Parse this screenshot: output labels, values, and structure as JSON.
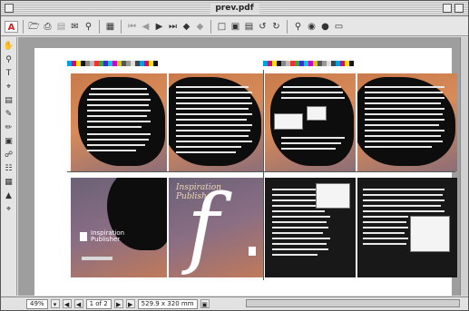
{
  "window": {
    "title": "prev.pdf"
  },
  "toolbar": {
    "icons": [
      "acrobat-logo-icon",
      "open-icon",
      "print-icon",
      "save-icon",
      "email-icon",
      "find-icon",
      "hand-icon",
      "first-page-icon",
      "previous-page-icon",
      "next-page-icon",
      "last-page-icon",
      "go-back-icon",
      "go-forward-icon",
      "actual-size-icon",
      "fit-page-icon",
      "fit-width-icon",
      "rotate-left-icon",
      "rotate-right-icon",
      "search-icon",
      "binoculars-icon",
      "web-icon",
      "cascade-icon"
    ]
  },
  "tools": [
    "hand-tool-icon",
    "zoom-tool-icon",
    "text-select-tool-icon",
    "crop-tool-icon",
    "note-tool-icon",
    "pencil-tool-icon",
    "highlight-tool-icon",
    "form-tool-icon",
    "link-tool-icon",
    "article-tool-icon",
    "movie-tool-icon",
    "stamp-tool-icon",
    "touchup-tool-icon"
  ],
  "document": {
    "cover": {
      "title_line1": "Inspiration",
      "title_line2": "Publisher",
      "initial": "f",
      "brand_line1": "Inspiration",
      "brand_line2": "Publisher"
    }
  },
  "status": {
    "zoom": "49%",
    "page_indicator": "1 of 2",
    "page_size": "529.9 x 320 mm"
  },
  "colors": {
    "desktop": "#d8473a",
    "window_chrome": "#dedede",
    "acrobat_red": "#d81e1e"
  }
}
